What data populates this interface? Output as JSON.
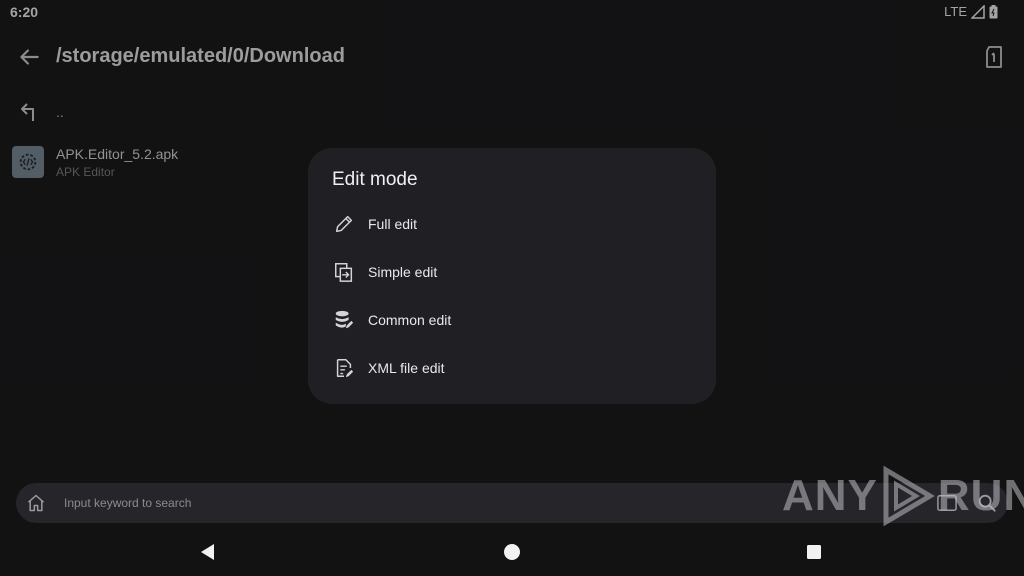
{
  "status": {
    "time": "6:20",
    "network": "LTE"
  },
  "appbar": {
    "path": "/storage/emulated/0/Download"
  },
  "list": {
    "parent_label": "..",
    "items": [
      {
        "name": "APK.Editor_5.2.apk",
        "subtitle": "APK Editor"
      }
    ]
  },
  "dialog": {
    "title": "Edit mode",
    "options": [
      {
        "label": "Full edit",
        "icon": "pencil-icon"
      },
      {
        "label": "Simple edit",
        "icon": "copy-arrow-icon"
      },
      {
        "label": "Common edit",
        "icon": "database-edit-icon"
      },
      {
        "label": "XML file edit",
        "icon": "file-edit-icon"
      }
    ]
  },
  "search": {
    "placeholder": "Input keyword to search"
  },
  "watermark": {
    "left": "ANY",
    "right": "RUN"
  },
  "colors": {
    "background": "#1b1b1d",
    "dialog": "#1f1f24",
    "searchbar": "#25252a",
    "apk_icon_bg": "#7b8a96"
  }
}
